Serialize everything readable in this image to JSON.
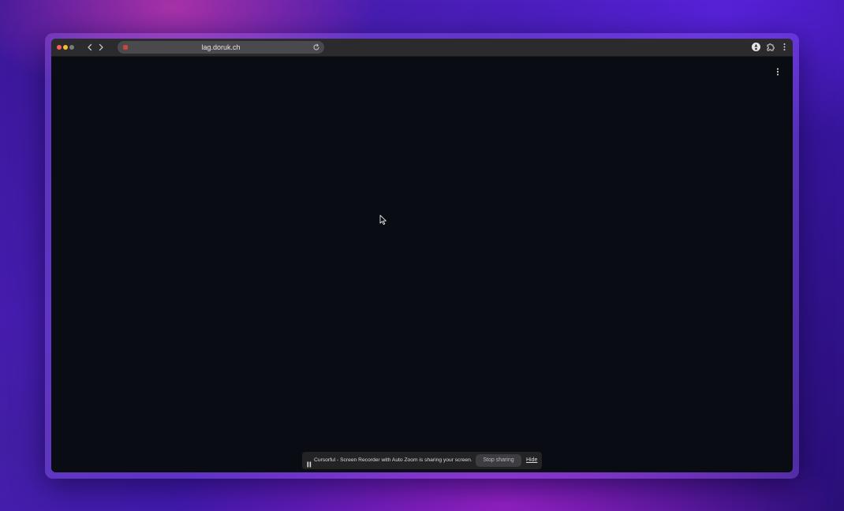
{
  "browser": {
    "url": "lag.doruk.ch",
    "nav": {
      "back_icon": "chevron-left-icon",
      "forward_icon": "chevron-right-icon",
      "reload_icon": "reload-icon"
    },
    "toolbar_icons": [
      "profile-icon",
      "extensions-icon",
      "kebab-menu-icon"
    ]
  },
  "page": {
    "background": "#0a0c14",
    "menu_icon": "kebab-menu-icon"
  },
  "screen_share_bar": {
    "message": "Cursorful - Screen Recorder with Auto Zoom is sharing your screen.",
    "stop_label": "Stop sharing",
    "hide_label": "Hide",
    "pause_icon": "pause-icon"
  },
  "colors": {
    "close": "#ff5f57",
    "minimize": "#febc2e",
    "titlebar": "#2b2b2e",
    "wallpaper_accent": "#4a1eb8"
  }
}
